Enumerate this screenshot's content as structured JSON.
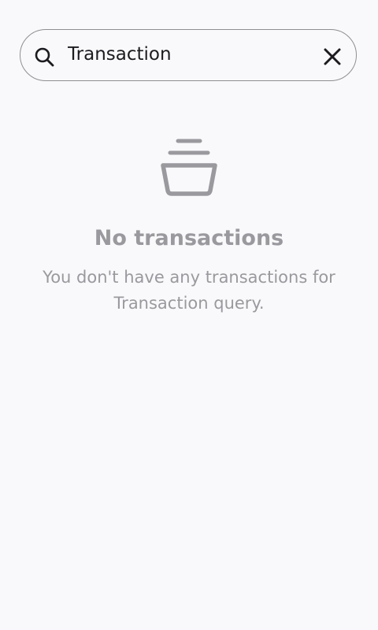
{
  "search": {
    "value": "Transaction",
    "search_icon": "search-icon",
    "clear_icon": "close-icon"
  },
  "empty_state": {
    "icon": "empty-basket-icon",
    "title": "No transactions",
    "description": "You don't have any transactions for Transaction query."
  },
  "colors": {
    "background": "#f9f9fb",
    "border": "#8f8f93",
    "muted_text": "#9a999e",
    "primary_text": "#1d1b20"
  }
}
